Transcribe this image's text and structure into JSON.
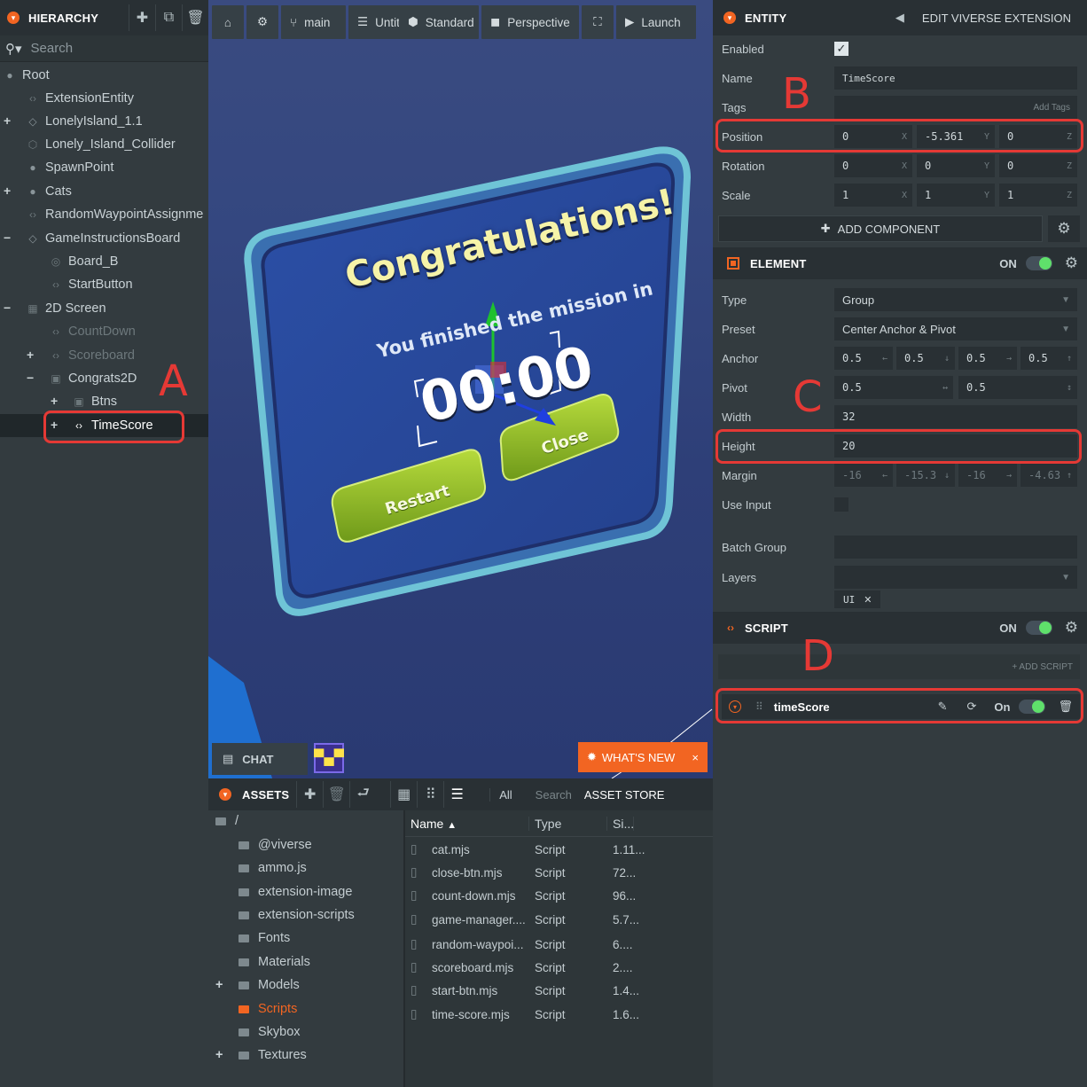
{
  "hierarchy": {
    "title": "HIERARCHY",
    "search_placeholder": "Search",
    "items": [
      {
        "label": "Root"
      },
      {
        "label": "ExtensionEntity"
      },
      {
        "label": "LonelyIsland_1.1"
      },
      {
        "label": "Lonely_Island_Collider"
      },
      {
        "label": "SpawnPoint"
      },
      {
        "label": "Cats"
      },
      {
        "label": "RandomWaypointAssignme"
      },
      {
        "label": "GameInstructionsBoard"
      },
      {
        "label": "Board_B"
      },
      {
        "label": "StartButton"
      },
      {
        "label": "2D Screen"
      },
      {
        "label": "CountDown"
      },
      {
        "label": "Scoreboard"
      },
      {
        "label": "Congrats2D"
      },
      {
        "label": "Btns"
      },
      {
        "label": "TimeScore"
      }
    ]
  },
  "toolbar": {
    "branch": "main",
    "scene": "Untitled",
    "layout": "Standard",
    "camera": "Perspective",
    "launch": "Launch"
  },
  "viewport": {
    "heading": "Congratulations!",
    "subtitle": "You finished the mission in",
    "timer": "00:00",
    "close_button": "Close",
    "restart_button": "Restart",
    "chat": "CHAT",
    "whats_new": "WHAT'S NEW"
  },
  "inspector": {
    "title": "ENTITY",
    "edit_extension": "EDIT VIVERSE EXTENSION",
    "enabled_label": "Enabled",
    "name_label": "Name",
    "name_value": "TimeScore",
    "tags_label": "Tags",
    "add_tags": "Add Tags",
    "position_label": "Position",
    "position": [
      "0",
      "-5.361",
      "0"
    ],
    "rotation_label": "Rotation",
    "rotation": [
      "0",
      "0",
      "0"
    ],
    "scale_label": "Scale",
    "scale": [
      "1",
      "1",
      "1"
    ],
    "axes": [
      "X",
      "Y",
      "Z"
    ],
    "add_component": "ADD COMPONENT",
    "element": {
      "title": "ELEMENT",
      "on": "ON",
      "type_label": "Type",
      "type_value": "Group",
      "preset_label": "Preset",
      "preset_value": "Center Anchor & Pivot",
      "anchor_label": "Anchor",
      "anchor": [
        "0.5",
        "0.5",
        "0.5",
        "0.5"
      ],
      "pivot_label": "Pivot",
      "pivot": [
        "0.5",
        "0.5"
      ],
      "width_label": "Width",
      "width_value": "32",
      "height_label": "Height",
      "height_value": "20",
      "margin_label": "Margin",
      "margin": [
        "-16",
        "-15.3",
        "-16",
        "-4.63"
      ],
      "use_input_label": "Use Input",
      "batch_group_label": "Batch Group",
      "layers_label": "Layers",
      "layer_tag": "UI"
    },
    "script": {
      "title": "SCRIPT",
      "on": "ON",
      "add_script": "+ ADD SCRIPT",
      "script_name": "timeScore",
      "script_on": "On"
    }
  },
  "assets": {
    "title": "ASSETS",
    "filter_all": "All",
    "search_placeholder": "Search",
    "asset_store": "ASSET STORE",
    "root_path": "/",
    "folders": [
      "@viverse",
      "ammo.js",
      "extension-image",
      "extension-scripts",
      "Fonts",
      "Materials",
      "Models",
      "Scripts",
      "Skybox",
      "Textures"
    ],
    "columns": [
      "Name",
      "Type",
      "Si..."
    ],
    "files": [
      {
        "name": "cat.mjs",
        "type": "Script",
        "size": "1.11..."
      },
      {
        "name": "close-btn.mjs",
        "type": "Script",
        "size": "72..."
      },
      {
        "name": "count-down.mjs",
        "type": "Script",
        "size": "96..."
      },
      {
        "name": "game-manager....",
        "type": "Script",
        "size": "5.7..."
      },
      {
        "name": "random-waypoi...",
        "type": "Script",
        "size": "6...."
      },
      {
        "name": "scoreboard.mjs",
        "type": "Script",
        "size": "2...."
      },
      {
        "name": "start-btn.mjs",
        "type": "Script",
        "size": "1.4..."
      },
      {
        "name": "time-score.mjs",
        "type": "Script",
        "size": "1.6..."
      }
    ]
  },
  "annotations": {
    "a": "A",
    "b": "B",
    "c": "C",
    "d": "D"
  },
  "colors": {
    "accent": "#f26522",
    "highlight": "#e53935",
    "toggle_on": "#5fe06b",
    "panel": "#333b3f"
  }
}
